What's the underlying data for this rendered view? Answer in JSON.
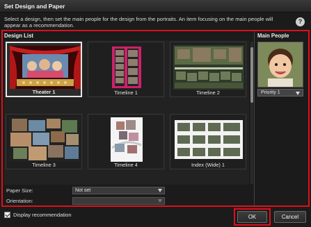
{
  "window": {
    "title": "Set Design and Paper"
  },
  "description": "Select a design, then set the main people for the design from the portraits. An item focusing on the main people will appear as a recommendation.",
  "design_list": {
    "heading": "Design List",
    "items": [
      {
        "label": "Theater 1"
      },
      {
        "label": "Timeline 1"
      },
      {
        "label": "Timeline 2"
      },
      {
        "label": "Timeline 3"
      },
      {
        "label": "Timeline 4"
      },
      {
        "label": "Index (Wide) 1"
      }
    ]
  },
  "paper": {
    "size_label": "Paper Size:",
    "size_value": "Not set",
    "orientation_label": "Orientation:",
    "orientation_value": ""
  },
  "main_people": {
    "heading": "Main People",
    "priority_value": "Priority 1"
  },
  "footer": {
    "display_recommendation_label": "Display recommendation",
    "ok_label": "OK",
    "cancel_label": "Cancel"
  },
  "colors": {
    "highlight": "#e0101a",
    "background": "#1b1b1b"
  }
}
